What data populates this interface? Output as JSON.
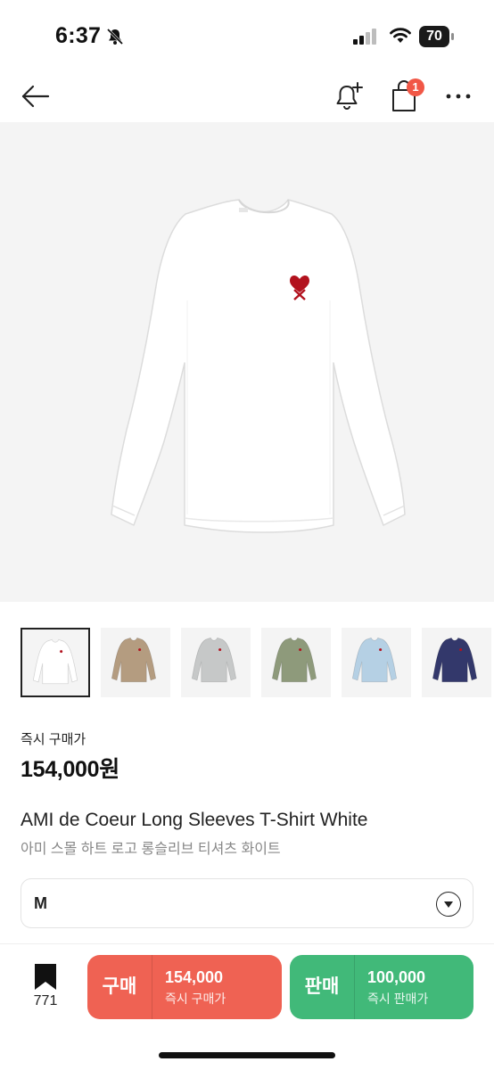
{
  "status_bar": {
    "time": "6:37",
    "battery": "70"
  },
  "nav": {
    "cart_badge": "1"
  },
  "colors": {
    "buy": "#ef6253",
    "sell": "#41b979",
    "badge": "#f15746"
  },
  "product": {
    "price_label": "즉시 구매가",
    "price": "154,000원",
    "title_en": "AMI de Coeur Long Sleeves T-Shirt White",
    "title_ko": "아미 스몰 하트 로고 롱슬리브 티셔츠 화이트"
  },
  "thumbnails": [
    {
      "color": "#ffffff",
      "selected": true
    },
    {
      "color": "#b49c80",
      "selected": false
    },
    {
      "color": "#c6c8c8",
      "selected": false
    },
    {
      "color": "#8e9a7b",
      "selected": false
    },
    {
      "color": "#b5d0e4",
      "selected": false
    },
    {
      "color": "#33386b",
      "selected": false
    }
  ],
  "size": {
    "selected": "M"
  },
  "bottom_bar": {
    "wish_count": "771",
    "buy": {
      "label": "구매",
      "price": "154,000",
      "sub": "즉시 구매가"
    },
    "sell": {
      "label": "판매",
      "price": "100,000",
      "sub": "즉시 판매가"
    }
  }
}
